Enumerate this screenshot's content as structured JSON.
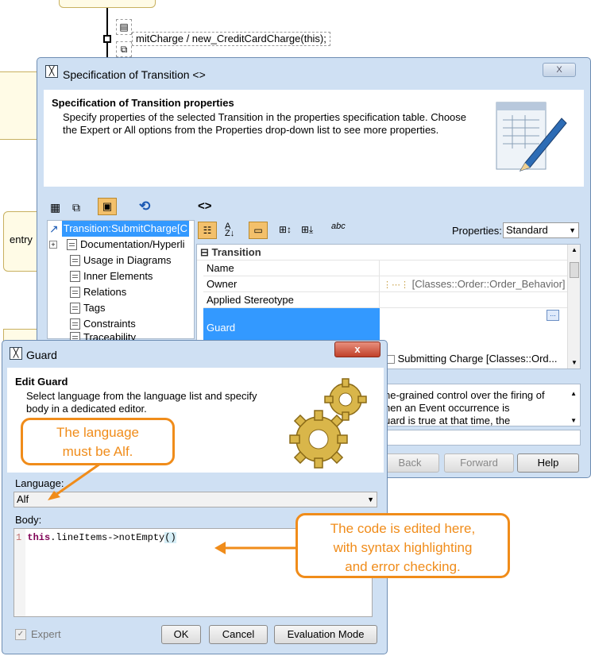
{
  "diagram": {
    "transition_label": "mitCharge / new_CreditCardCharge(this);",
    "entry_label": "entry"
  },
  "spec_window": {
    "title": "Specification of Transition <>",
    "close_symbol": "X",
    "header_title": "Specification of Transition properties",
    "header_desc": "Specify properties of the selected Transition in the properties specification table. Choose the Expert or All options from the Properties drop-down list to see more properties.",
    "panel_title": "<>",
    "tree": {
      "root": "Transition:SubmitCharge[C",
      "items": [
        "Documentation/Hyperli",
        "Usage in Diagrams",
        "Inner Elements",
        "Relations",
        "Tags",
        "Constraints",
        "Traceability"
      ]
    },
    "properties_label": "Properties:",
    "properties_value": "Standard",
    "abc_label": "abc",
    "group_title": "Transition",
    "rows": [
      {
        "name": "Name",
        "value": ""
      },
      {
        "name": "Owner",
        "value": "[Classes::Order::Order_Behavior]"
      },
      {
        "name": "Applied Stereotype",
        "value": ""
      },
      {
        "name": "Guard",
        "value": ""
      }
    ],
    "source_value": "Submitting Charge [Classes::Ord...",
    "desc_lines": [
      "ne-grained control over the firing of",
      "hen an Event occurrence is",
      "uard is true at that time, the"
    ],
    "buttons": {
      "back": "Back",
      "forward": "Forward",
      "help": "Help"
    }
  },
  "guard_dialog": {
    "title": "Guard",
    "close_symbol": "x",
    "header_title": "Edit Guard",
    "header_desc": "Select language from the language list and specify body in a dedicated editor.",
    "language_label": "Language:",
    "language_value": "Alf",
    "body_label": "Body:",
    "code": {
      "line_no": "1",
      "keyword": "this",
      "rest": ".lineItems->notEmpty",
      "parens": "()"
    },
    "expert_label": "Expert",
    "buttons": {
      "ok": "OK",
      "cancel": "Cancel",
      "eval": "Evaluation Mode"
    }
  },
  "callouts": {
    "language": [
      "The language",
      "must be Alf."
    ],
    "code": [
      "The code is edited here,",
      "with syntax highlighting",
      "and error checking."
    ]
  },
  "colors": {
    "accent_orange": "#f08c1a",
    "selection_blue": "#3399ff",
    "keyword_purple": "#7f0055"
  }
}
